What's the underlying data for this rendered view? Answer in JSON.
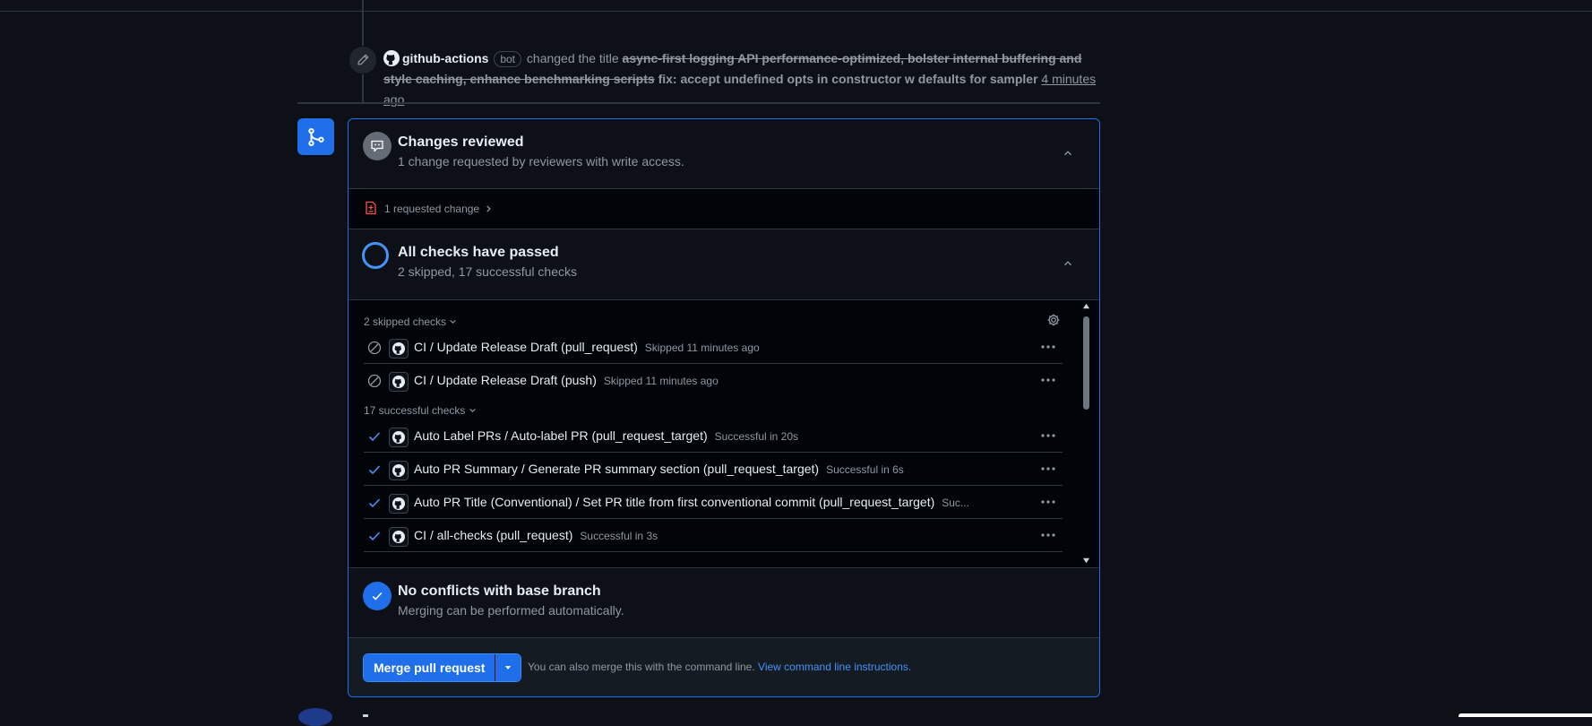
{
  "event": {
    "actor": "github-actions",
    "badge": "bot",
    "action": "changed the title",
    "old_title": "async-first logging API performance-optimized, bolster internal buffering and style caching, enhance benchmarking scripts",
    "new_title": "fix: accept undefined opts in constructor w defaults for sampler",
    "time": "4 minutes ago"
  },
  "reviews": {
    "title": "Changes reviewed",
    "subtitle": "1 change requested by reviewers with write access.",
    "requested_link": "1 requested change"
  },
  "checks": {
    "title": "All checks have passed",
    "subtitle": "2 skipped, 17 successful checks",
    "skipped_label": "2 skipped checks",
    "successful_label": "17 successful checks",
    "skipped": [
      {
        "name": "CI / Update Release Draft (pull_request)",
        "meta": "Skipped 11 minutes ago"
      },
      {
        "name": "CI / Update Release Draft (push)",
        "meta": "Skipped 11 minutes ago"
      }
    ],
    "successful": [
      {
        "name": "Auto Label PRs / Auto-label PR (pull_request_target)",
        "meta": "Successful in 20s"
      },
      {
        "name": "Auto PR Summary / Generate PR summary section (pull_request_target)",
        "meta": "Successful in 6s"
      },
      {
        "name": "Auto PR Title (Conventional) / Set PR title from first conventional commit (pull_request_target)",
        "meta": "Suc..."
      },
      {
        "name": "CI / all-checks (pull_request)",
        "meta": "Successful in 3s"
      }
    ]
  },
  "conflicts": {
    "title": "No conflicts with base branch",
    "subtitle": "Merging can be performed automatically."
  },
  "merge": {
    "button_label": "Merge pull request",
    "hint": "You can also merge this with the command line.",
    "link": "View command line instructions."
  },
  "colors": {
    "accent": "#1f6feb",
    "danger": "#f85149",
    "success_check": "#4493f8",
    "background": "#0d1117"
  }
}
